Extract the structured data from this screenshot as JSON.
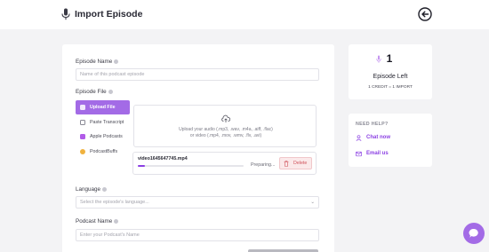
{
  "header": {
    "title": "Import Episode"
  },
  "form": {
    "episode_name": {
      "label": "Episode Name",
      "placeholder": "Name of this podcast episode"
    },
    "episode_file": {
      "label": "Episode File",
      "sources": [
        {
          "label": "Upload File",
          "icon": "upload-icon",
          "active": true
        },
        {
          "label": "Paste Transcript",
          "icon": "transcript-icon",
          "active": false
        },
        {
          "label": "Apple Podcasts",
          "icon": "apple-podcasts-icon",
          "active": false
        },
        {
          "label": "PodcastBuffs",
          "icon": "podcastbuffs-icon",
          "active": false
        }
      ],
      "dropzone": {
        "line1": "Upload your audio (.mp3, .wav, .m4a, .aiff, .flac)",
        "line2": "or video (.mp4, .mov, .wmv, .flv, .avi)"
      },
      "upload": {
        "filename": "video1645647745.mp4",
        "status": "Preparing...",
        "progress": 0.07,
        "delete_label": "Delete"
      }
    },
    "language": {
      "label": "Language",
      "placeholder": "Select the episode's language..."
    },
    "podcast_name": {
      "label": "Podcast Name",
      "placeholder": "Enter your Podcast's Name"
    }
  },
  "credits": {
    "count": "1",
    "title": "Episode Left",
    "note": "1 CREDIT = 1 IMPORT"
  },
  "help": {
    "heading": "NEED HELP?",
    "chat_label": "Chat now",
    "email_label": "Email us"
  },
  "colors": {
    "accent": "#8b3fe3",
    "accent_light": "#a36be6",
    "danger": "#d0535c",
    "background": "#f3f3f5"
  }
}
